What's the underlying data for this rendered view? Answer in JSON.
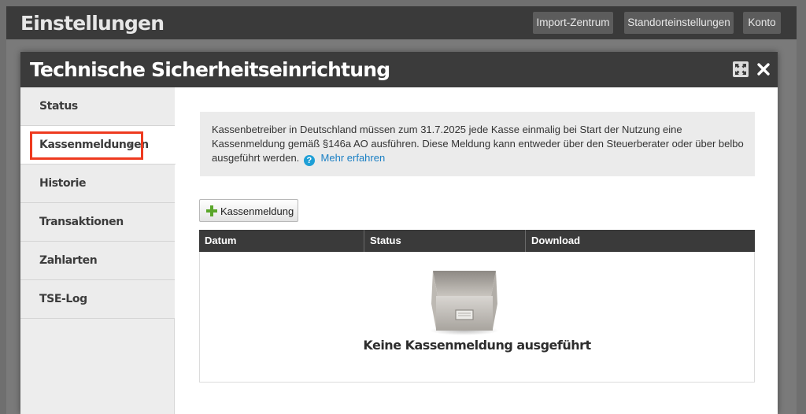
{
  "app": {
    "title": "Einstellungen",
    "buttons": [
      {
        "label": "Import-Zentrum"
      },
      {
        "label": "Standorteinstellungen"
      },
      {
        "label": "Konto"
      }
    ]
  },
  "dialog": {
    "title": "Technische Sicherheitseinrichtung",
    "icons": [
      "expand-icon",
      "close-icon"
    ]
  },
  "sidebar": {
    "items": [
      {
        "label": "Status"
      },
      {
        "label": "Kassenmeldungen",
        "active": true,
        "chevron": "›"
      },
      {
        "label": "Historie"
      },
      {
        "label": "Transaktionen"
      },
      {
        "label": "Zahlarten"
      },
      {
        "label": "TSE-Log"
      }
    ]
  },
  "info": {
    "line1": "Kassenbetreiber in Deutschland müssen zum 31.7.2025 jede Kasse einmalig bei Start der Nutzung eine",
    "line2": "Kassenmeldung gemäß §146a AO ausführen. Diese Meldung kann entweder über den Steuerberater oder über belbo",
    "line3": "ausgeführt werden.",
    "help_glyph": "?",
    "link": "Mehr erfahren"
  },
  "actions": {
    "add_label": "Kassenmeldung"
  },
  "table": {
    "columns": [
      "Datum",
      "Status",
      "Download"
    ],
    "rows": [],
    "empty_text": "Keine Kassenmeldung ausgeführt"
  },
  "colors": {
    "header": "#3b3b3b",
    "accent_link": "#1a7fc4",
    "highlight": "#ee3a1f",
    "plus_green": "#5aa62a"
  }
}
